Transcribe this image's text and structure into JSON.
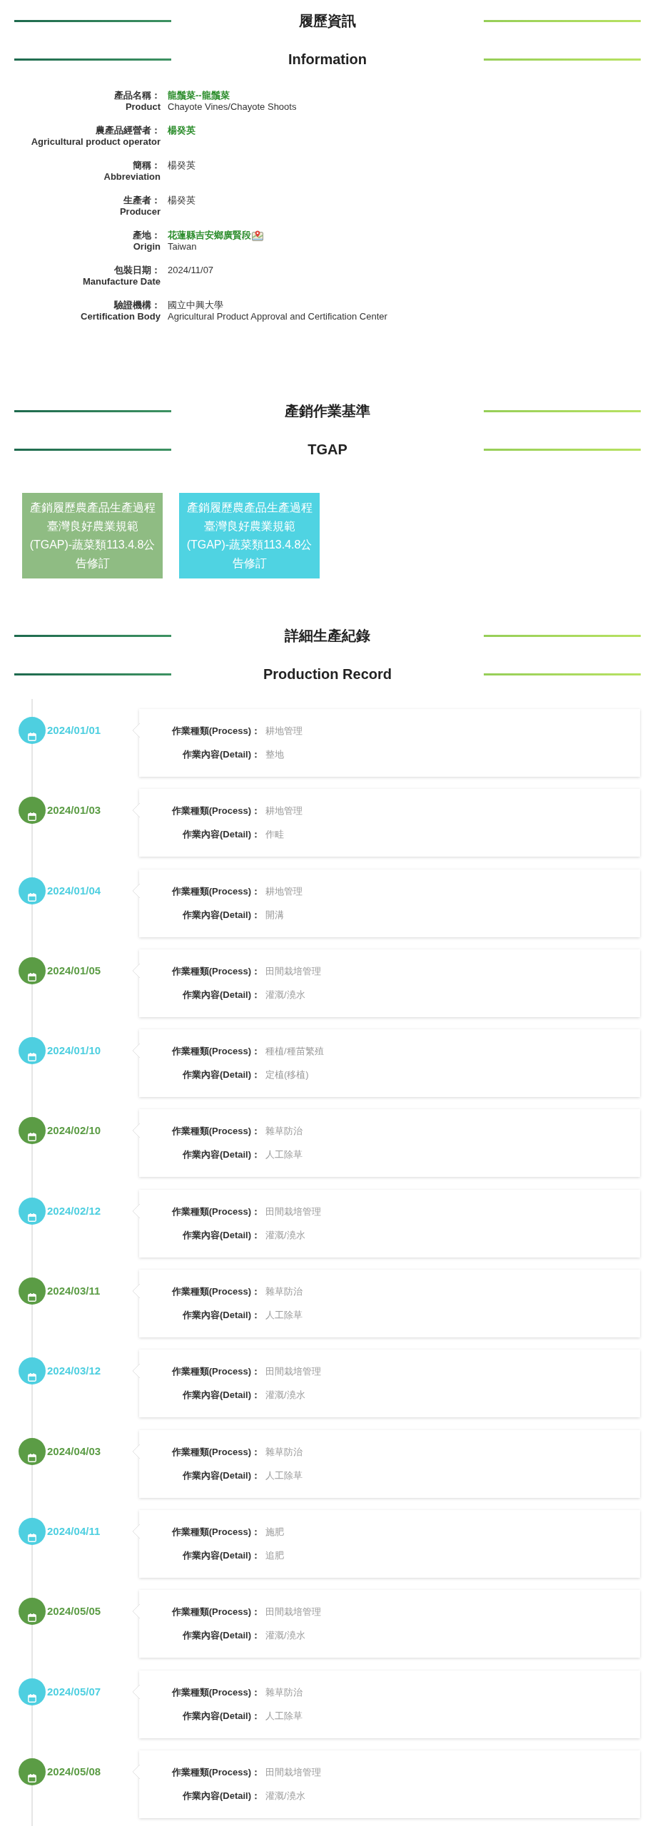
{
  "info_section": {
    "title": "履歷資訊",
    "title_en": "Information",
    "fields": [
      {
        "label": "產品名稱：",
        "label_en": "Product",
        "value": "龍鬚菜--龍鬚菜",
        "value_en": "Chayote Vines/Chayote Shoots",
        "highlighted": true,
        "kind": "plain"
      },
      {
        "label": "農產品經營者：",
        "label_en": "Agricultural product operator",
        "value": "楊癸英",
        "highlighted": true,
        "kind": "plain"
      },
      {
        "label": "簡稱：",
        "label_en": "Abbreviation",
        "value": "楊癸英",
        "highlighted": false,
        "kind": "plain"
      },
      {
        "label": "生產者：",
        "label_en": "Producer",
        "value": "楊癸英",
        "highlighted": false,
        "kind": "plain"
      },
      {
        "label": "產地：",
        "label_en": "Origin",
        "value": "花蓮縣吉安鄉廣賢段",
        "value_en": "Taiwan",
        "highlighted": true,
        "kind": "place"
      },
      {
        "label": "包裝日期：",
        "label_en": "Manufacture Date",
        "value": "2024/11/07",
        "highlighted": false,
        "kind": "plain"
      },
      {
        "label": "驗證機構：",
        "label_en": "Certification Body",
        "value": "國立中興大學",
        "value_en": "Agricultural Product Approval and Certification Center",
        "highlighted": false,
        "kind": "plain"
      }
    ]
  },
  "standard_section": {
    "title": "產銷作業基準",
    "title_en": "TGAP",
    "documents": [
      {
        "text": "產銷履歷農產品生產過程臺灣良好農業規範(TGAP)-蔬菜類113.4.8公告修訂",
        "color": "#8fbc83"
      },
      {
        "text": "產銷履歷農產品生產過程臺灣良好農業規範(TGAP)-蔬菜類113.4.8公告修訂",
        "color": "#4fd3e2"
      }
    ]
  },
  "record_section": {
    "title": "詳細生產紀錄",
    "title_en": "Production Record",
    "records": [
      {
        "date": "2024/01/01",
        "color": "#4ecfe0",
        "process_label": "作業種類(Process)：",
        "process": "耕地管理",
        "detail_label": "作業內容(Detail)：",
        "detail": "整地"
      },
      {
        "date": "2024/01/03",
        "color": "#5b9c45",
        "process_label": "作業種類(Process)：",
        "process": "耕地管理",
        "detail_label": "作業內容(Detail)：",
        "detail": "作畦"
      },
      {
        "date": "2024/01/04",
        "color": "#4ecfe0",
        "process_label": "作業種類(Process)：",
        "process": "耕地管理",
        "detail_label": "作業內容(Detail)：",
        "detail": "開溝"
      },
      {
        "date": "2024/01/05",
        "color": "#5b9c45",
        "process_label": "作業種類(Process)：",
        "process": "田間栽培管理",
        "detail_label": "作業內容(Detail)：",
        "detail": "灌溉/澆水"
      },
      {
        "date": "2024/01/10",
        "color": "#4ecfe0",
        "process_label": "作業種類(Process)：",
        "process": "種植/種苗繁殖",
        "detail_label": "作業內容(Detail)：",
        "detail": "定植(移植)"
      },
      {
        "date": "2024/02/10",
        "color": "#5b9c45",
        "process_label": "作業種類(Process)：",
        "process": "雜草防治",
        "detail_label": "作業內容(Detail)：",
        "detail": "人工除草"
      },
      {
        "date": "2024/02/12",
        "color": "#4ecfe0",
        "process_label": "作業種類(Process)：",
        "process": "田間栽培管理",
        "detail_label": "作業內容(Detail)：",
        "detail": "灌溉/澆水"
      },
      {
        "date": "2024/03/11",
        "color": "#5b9c45",
        "process_label": "作業種類(Process)：",
        "process": "雜草防治",
        "detail_label": "作業內容(Detail)：",
        "detail": "人工除草"
      },
      {
        "date": "2024/03/12",
        "color": "#4ecfe0",
        "process_label": "作業種類(Process)：",
        "process": "田間栽培管理",
        "detail_label": "作業內容(Detail)：",
        "detail": "灌溉/澆水"
      },
      {
        "date": "2024/04/03",
        "color": "#5b9c45",
        "process_label": "作業種類(Process)：",
        "process": "雜草防治",
        "detail_label": "作業內容(Detail)：",
        "detail": "人工除草"
      },
      {
        "date": "2024/04/11",
        "color": "#4ecfe0",
        "process_label": "作業種類(Process)：",
        "process": "施肥",
        "detail_label": "作業內容(Detail)：",
        "detail": "追肥"
      },
      {
        "date": "2024/05/05",
        "color": "#5b9c45",
        "process_label": "作業種類(Process)：",
        "process": "田間栽培管理",
        "detail_label": "作業內容(Detail)：",
        "detail": "灌溉/澆水"
      },
      {
        "date": "2024/05/07",
        "color": "#4ecfe0",
        "process_label": "作業種類(Process)：",
        "process": "雜草防治",
        "detail_label": "作業內容(Detail)：",
        "detail": "人工除草"
      },
      {
        "date": "2024/05/08",
        "color": "#5b9c45",
        "process_label": "作業種類(Process)：",
        "process": "田間栽培管理",
        "detail_label": "作業內容(Detail)：",
        "detail": "灌溉/澆水"
      }
    ]
  }
}
